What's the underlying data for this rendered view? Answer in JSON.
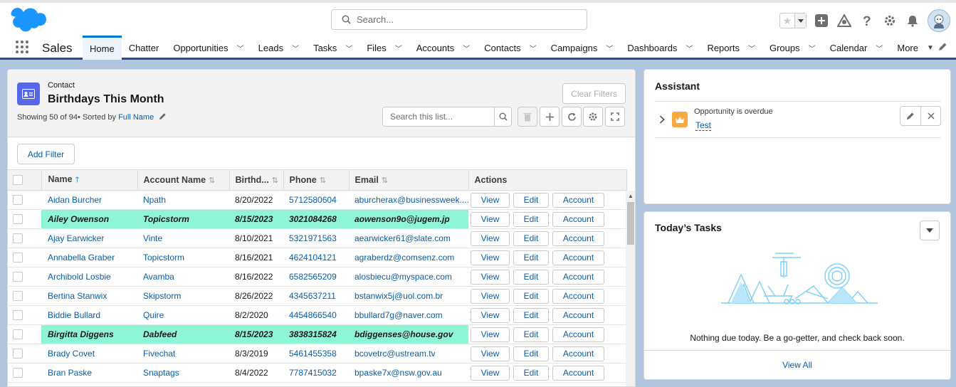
{
  "header": {
    "search_placeholder": "Search...",
    "colors": {
      "brand": "#1b96ff",
      "accent": "#0176d3"
    }
  },
  "nav": {
    "app_name": "Sales",
    "items": [
      {
        "label": "Home",
        "active": true,
        "dropdown": false
      },
      {
        "label": "Chatter",
        "dropdown": false
      },
      {
        "label": "Opportunities",
        "dropdown": true
      },
      {
        "label": "Leads",
        "dropdown": true
      },
      {
        "label": "Tasks",
        "dropdown": true
      },
      {
        "label": "Files",
        "dropdown": true
      },
      {
        "label": "Accounts",
        "dropdown": true
      },
      {
        "label": "Contacts",
        "dropdown": true
      },
      {
        "label": "Campaigns",
        "dropdown": true
      },
      {
        "label": "Dashboards",
        "dropdown": true
      },
      {
        "label": "Reports",
        "dropdown": true
      },
      {
        "label": "Groups",
        "dropdown": true
      },
      {
        "label": "Calendar",
        "dropdown": true
      },
      {
        "label": "More",
        "dropdown": true
      }
    ]
  },
  "list": {
    "object_label": "Contact",
    "title": "Birthdays This Month",
    "info_prefix": "Showing 50 of 94• Sorted by ",
    "sort_field": "Full Name",
    "clear_filters": "Clear Filters",
    "search_placeholder": "Search this list...",
    "add_filter": "Add Filter",
    "columns": [
      "Name",
      "Account Name",
      "Birthd...",
      "Phone",
      "Email",
      "Actions"
    ],
    "actions": {
      "view": "View",
      "edit": "Edit",
      "account": "Account"
    },
    "rows": [
      {
        "name": "Aidan Burcher",
        "account": "Npath",
        "birthdate": "8/20/2022",
        "phone": "5712580604",
        "email": "aburcherax@businessweek....",
        "highlight": false
      },
      {
        "name": "Ailey Owenson",
        "account": "Topicstorm",
        "birthdate": "8/15/2023",
        "phone": "3021084268",
        "email": "aowenson9o@jugem.jp",
        "highlight": true
      },
      {
        "name": "Ajay Earwicker",
        "account": "Vinte",
        "birthdate": "8/10/2021",
        "phone": "5321971563",
        "email": "aearwicker61@slate.com",
        "highlight": false
      },
      {
        "name": "Annabella Graber",
        "account": "Topicstorm",
        "birthdate": "8/16/2021",
        "phone": "4624104121",
        "email": "agraberdz@comsenz.com",
        "highlight": false
      },
      {
        "name": "Archibold Losbie",
        "account": "Avamba",
        "birthdate": "8/16/2022",
        "phone": "6582565209",
        "email": "alosbiecu@myspace.com",
        "highlight": false
      },
      {
        "name": "Bertina Stanwix",
        "account": "Skipstorm",
        "birthdate": "8/26/2022",
        "phone": "4345637211",
        "email": "bstanwix5j@uol.com.br",
        "highlight": false
      },
      {
        "name": "Biddie Bullard",
        "account": "Quire",
        "birthdate": "8/2/2020",
        "phone": "4454866540",
        "email": "bbullard7g@naver.com",
        "highlight": false
      },
      {
        "name": "Birgitta Diggens",
        "account": "Dabfeed",
        "birthdate": "8/15/2023",
        "phone": "3838315824",
        "email": "bdiggenses@house.gov",
        "highlight": true
      },
      {
        "name": "Brady Covet",
        "account": "Fivechat",
        "birthdate": "8/3/2019",
        "phone": "5461455358",
        "email": "bcovetrc@ustream.tv",
        "highlight": false
      },
      {
        "name": "Bran Paske",
        "account": "Snaptags",
        "birthdate": "8/4/2022",
        "phone": "7787415032",
        "email": "bpaske7x@nsw.gov.au",
        "highlight": false
      }
    ]
  },
  "assistant": {
    "title": "Assistant",
    "item_text": "Opportunity is overdue",
    "item_link": "Test"
  },
  "tasks": {
    "title": "Today’s Tasks",
    "empty_text": "Nothing due today. Be a go-getter, and check back soon.",
    "view_all": "View All"
  }
}
